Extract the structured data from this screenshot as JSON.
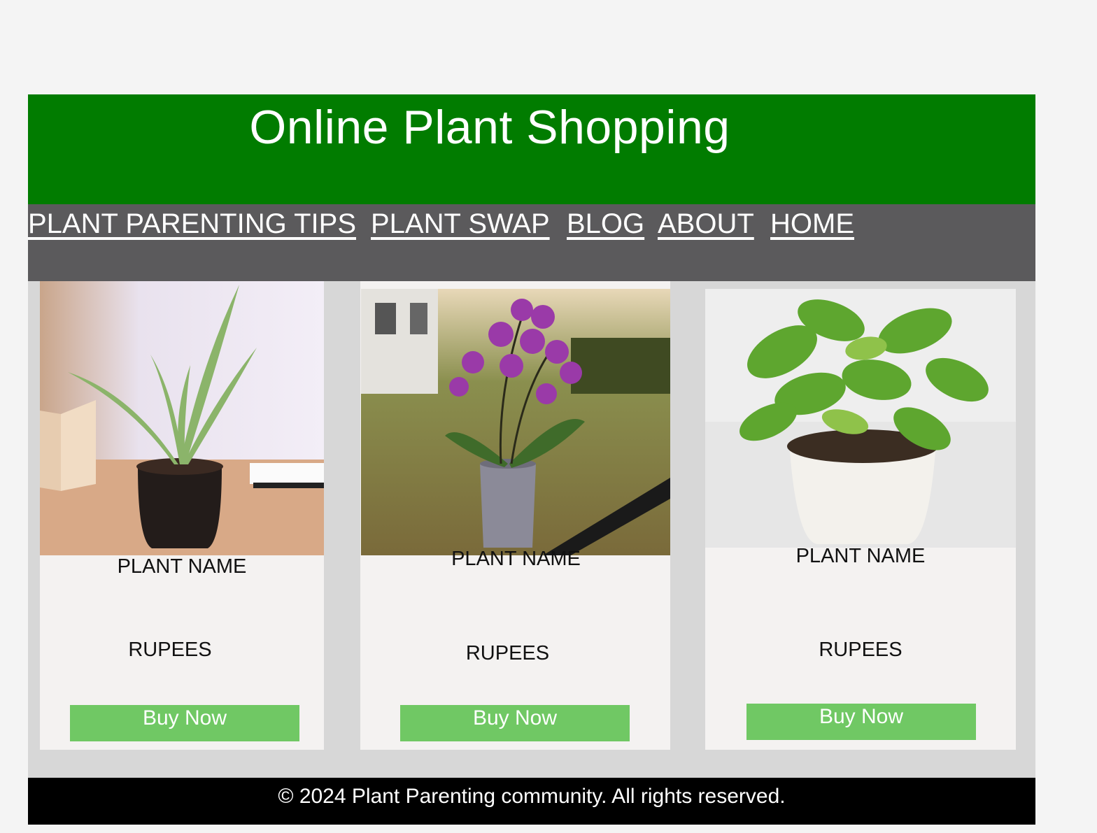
{
  "header": {
    "title": "Online Plant Shopping"
  },
  "nav": {
    "items": [
      "PLANT PARENTING TIPS",
      "PLANT SWAP",
      "BLOG",
      "ABOUT",
      "HOME"
    ]
  },
  "products": [
    {
      "name": "PLANT NAME",
      "price": "RUPEES",
      "button": "Buy Now",
      "image_icon": "aloe-vera-plant"
    },
    {
      "name": "PLANT NAME",
      "price": "RUPEES",
      "button": "Buy Now",
      "image_icon": "orchid-plant"
    },
    {
      "name": "PLANT NAME",
      "price": "RUPEES",
      "button": "Buy Now",
      "image_icon": "money-plant"
    }
  ],
  "footer": {
    "text": "© 2024 Plant Parenting community. All rights reserved."
  },
  "colors": {
    "header_bg": "#017c00",
    "nav_bg": "#5b5a5c",
    "content_bg": "#d7d7d7",
    "card_bg": "#f4f2f1",
    "button_bg": "#70c864",
    "footer_bg": "#000000"
  }
}
